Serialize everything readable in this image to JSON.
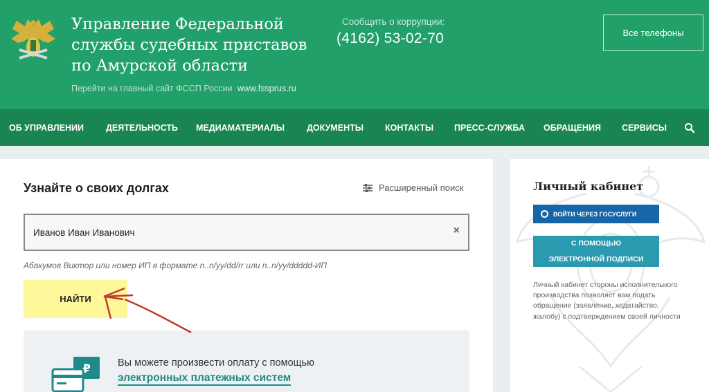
{
  "header": {
    "title": "Управление Федеральной службы судебных приставов по Амурской области",
    "main_link_text": "Перейти на главный сайт ФССП России",
    "main_link_url": "www.fssprus.ru",
    "corruption_label": "Сообщить о коррупции:",
    "corruption_phone": "(4162) 53-02-70",
    "all_phones_label": "Все телефоны",
    "emblem_icon": "eagle-emblem-icon"
  },
  "nav": {
    "items": [
      "ОБ УПРАВЛЕНИИ",
      "ДЕЯТЕЛЬНОСТЬ",
      "МЕДИАМАТЕРИАЛЫ",
      "ДОКУМЕНТЫ",
      "КОНТАКТЫ",
      "ПРЕСС-СЛУЖБА",
      "ОБРАЩЕНИЯ",
      "СЕРВИСЫ"
    ],
    "search_icon": "search-icon"
  },
  "debts": {
    "title": "Узнайте о своих долгах",
    "advanced_search": "Расширенный поиск",
    "search_value": "Иванов Иван Иванович",
    "clear_symbol": "×",
    "hint": "Абакумов Виктор или номер ИП в формате n..n/yy/dd/rr или n..n/yy/ddddd-ИП",
    "find_label": "НАЙТИ",
    "payment_text": "Вы можете произвести оплату с помощью",
    "payment_link": "электронных платежных систем",
    "payment_icon_symbol": "₽"
  },
  "cabinet": {
    "title": "Личный кабинет",
    "gosuslugi_button": "ВОЙТИ ЧЕРЕЗ ГОСУСЛУГИ",
    "signature_button_line1": "С ПОМОЩЬЮ",
    "signature_button_line2": "ЭЛЕКТРОННОЙ ПОДПИСИ",
    "description": "Личный кабинет стороны исполнительного производства позволяет вам подать обращение (заявление, ходатайство, жалобу) с подтверждением своей личности"
  },
  "colors": {
    "header_green": "#21a06a",
    "nav_green": "#198553",
    "find_button_yellow": "#fdf79a",
    "gosuslugi_blue": "#1565a8",
    "signature_teal": "#2a9ab0",
    "arrow_red": "#c0392b"
  }
}
